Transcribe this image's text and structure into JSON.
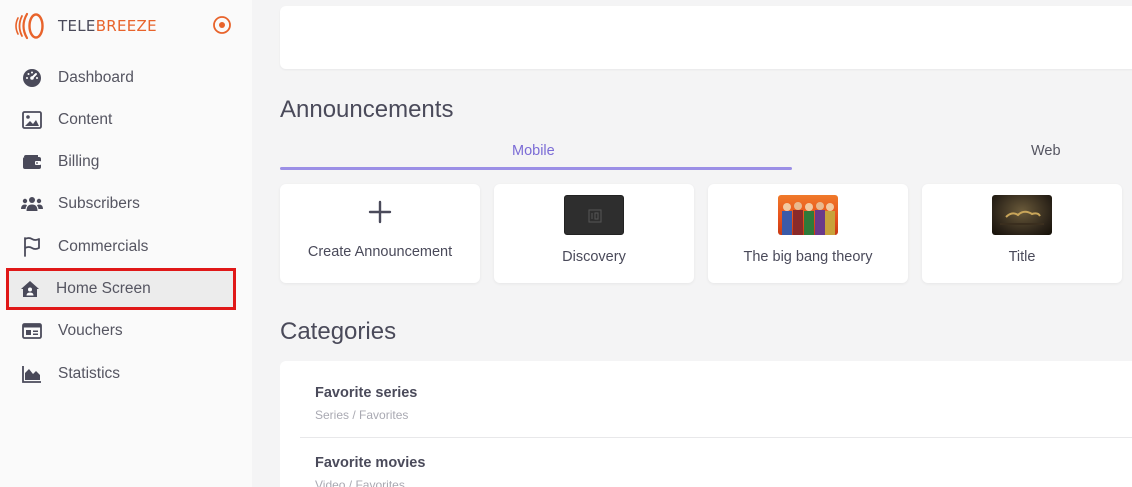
{
  "app": {
    "brand_part1": "TELE",
    "brand_part2": "BREEZE",
    "accent_color": "#e8632b",
    "settings_icon": "target-icon"
  },
  "sidebar": {
    "items": [
      {
        "label": "Dashboard",
        "icon": "dashboard-gauge-icon"
      },
      {
        "label": "Content",
        "icon": "image-icon"
      },
      {
        "label": "Billing",
        "icon": "wallet-icon"
      },
      {
        "label": "Subscribers",
        "icon": "users-icon"
      },
      {
        "label": "Commercials",
        "icon": "flag-icon"
      },
      {
        "label": "Home Screen",
        "icon": "house-user-icon",
        "active": true
      },
      {
        "label": "Vouchers",
        "icon": "id-card-icon"
      },
      {
        "label": "Statistics",
        "icon": "area-chart-icon"
      }
    ],
    "active_highlight_color": "#e01818"
  },
  "announcements": {
    "title": "Announcements",
    "tabs": [
      {
        "label": "Mobile",
        "active": true
      },
      {
        "label": "Web",
        "active": false
      }
    ],
    "tab_accent_color": "#7b6cd6",
    "cards": [
      {
        "label": "Create Announcement",
        "icon": "plus-icon"
      },
      {
        "label": "Discovery",
        "thumb": "dark-logo-thumbnail"
      },
      {
        "label": "The big bang theory",
        "thumb": "cast-photo-thumbnail"
      },
      {
        "label": "Title",
        "thumb": "movie-poster-thumbnail"
      }
    ]
  },
  "categories": {
    "title": "Categories",
    "items": [
      {
        "name": "Favorite series",
        "path": "Series / Favorites"
      },
      {
        "name": "Favorite movies",
        "path": "Video / Favorites"
      }
    ]
  }
}
